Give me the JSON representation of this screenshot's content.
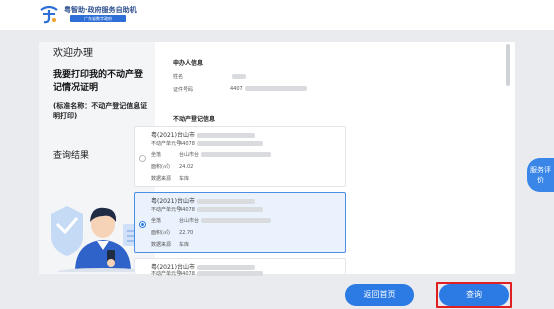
{
  "header": {
    "logo_title": "粤智助·政府服务自助机",
    "logo_sub": "广东省数字政府"
  },
  "left": {
    "welcome": "欢迎办理",
    "apply_title": "我要打印我的不动产登记情况证明",
    "std_name": "(标准名称：不动产登记信息证明打印)",
    "result_label": "查询结果"
  },
  "applicant": {
    "title": "申办人信息",
    "name_label": "姓名",
    "id_label": "证件号码",
    "id_value_prefix": "4407"
  },
  "property": {
    "title": "不动产登记信息",
    "records": [
      {
        "cert": "粤(2021)台山市",
        "unit_label": "不动产单元号",
        "unit_prefix": "44078",
        "location_label": "坐落",
        "location_prefix": "台山市台",
        "area_label": "面积(㎡)",
        "area": "24.02",
        "source_label": "数据来源",
        "source": "车库",
        "selected": false
      },
      {
        "cert": "粤(2021)台山市",
        "unit_label": "不动产单元号",
        "unit_prefix": "44078",
        "location_label": "坐落",
        "location_prefix": "台山市台",
        "area_label": "面积(㎡)",
        "area": "22.70",
        "source_label": "数据来源",
        "source": "车库",
        "selected": true
      },
      {
        "cert": "粤(2021)台山市",
        "unit_label": "不动产单元号",
        "unit_prefix": "44078",
        "location_label": "",
        "location_prefix": "",
        "area_label": "",
        "area": "",
        "source_label": "",
        "source": "",
        "selected": false
      }
    ]
  },
  "side": {
    "service": "服务评价"
  },
  "buttons": {
    "home": "返回首页",
    "query": "查询"
  },
  "colors": {
    "primary": "#2c7be5",
    "highlight": "#e02020",
    "selected_bg": "#eaf2fd"
  }
}
